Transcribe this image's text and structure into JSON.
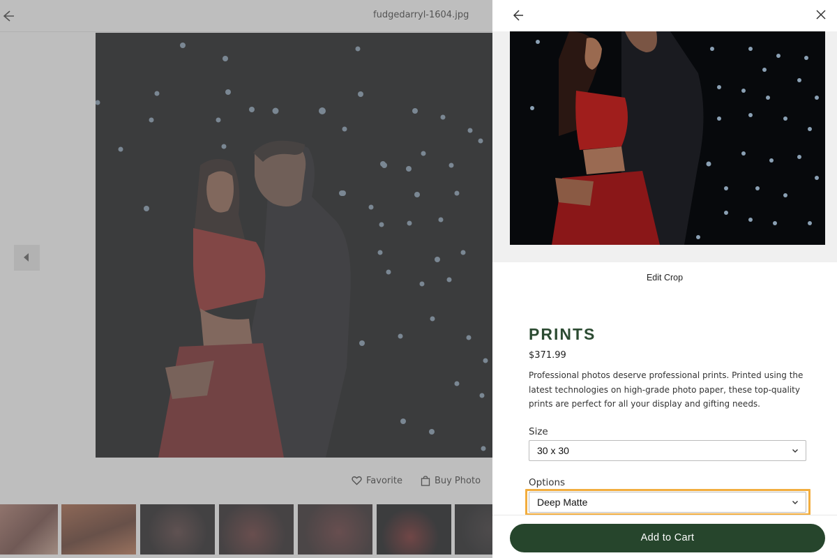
{
  "viewer": {
    "filename": "fudgedarryl-1604.jpg",
    "favorite_label": "Favorite",
    "buy_label": "Buy Photo",
    "back_icon": "arrow-left-icon",
    "prev_icon": "caret-left-icon",
    "thumbnails": [
      {
        "name": "thumb-1",
        "tone": "#9a6a5a"
      },
      {
        "name": "thumb-2",
        "tone": "#8a4a32"
      },
      {
        "name": "thumb-3",
        "tone": "#1e1b1c"
      },
      {
        "name": "thumb-4",
        "tone": "#2a1d1d"
      },
      {
        "name": "thumb-5",
        "tone": "#3a2325"
      },
      {
        "name": "thumb-6",
        "tone": "#0b0c10",
        "selected": true
      },
      {
        "name": "thumb-7",
        "tone": "#141517"
      }
    ]
  },
  "panel": {
    "close_icon": "close-icon",
    "back_icon": "arrow-left-icon",
    "edit_crop_label": "Edit Crop",
    "product_title": "PRINTS",
    "price": "$371.99",
    "description": "Professional photos deserve professional prints. Printed using the latest technologies on high-grade photo paper, these top-quality prints are perfect for all your display and gifting needs.",
    "size": {
      "label": "Size",
      "selected": "30 x 30"
    },
    "options": {
      "label": "Options",
      "selected": "Deep Matte"
    },
    "add_to_cart_label": "Add to Cart"
  },
  "colors": {
    "brand_green": "#26452c",
    "title_green": "#2c4b32",
    "highlight": "#f2ad3e",
    "overlay": "rgba(120,120,120,0.48)"
  }
}
